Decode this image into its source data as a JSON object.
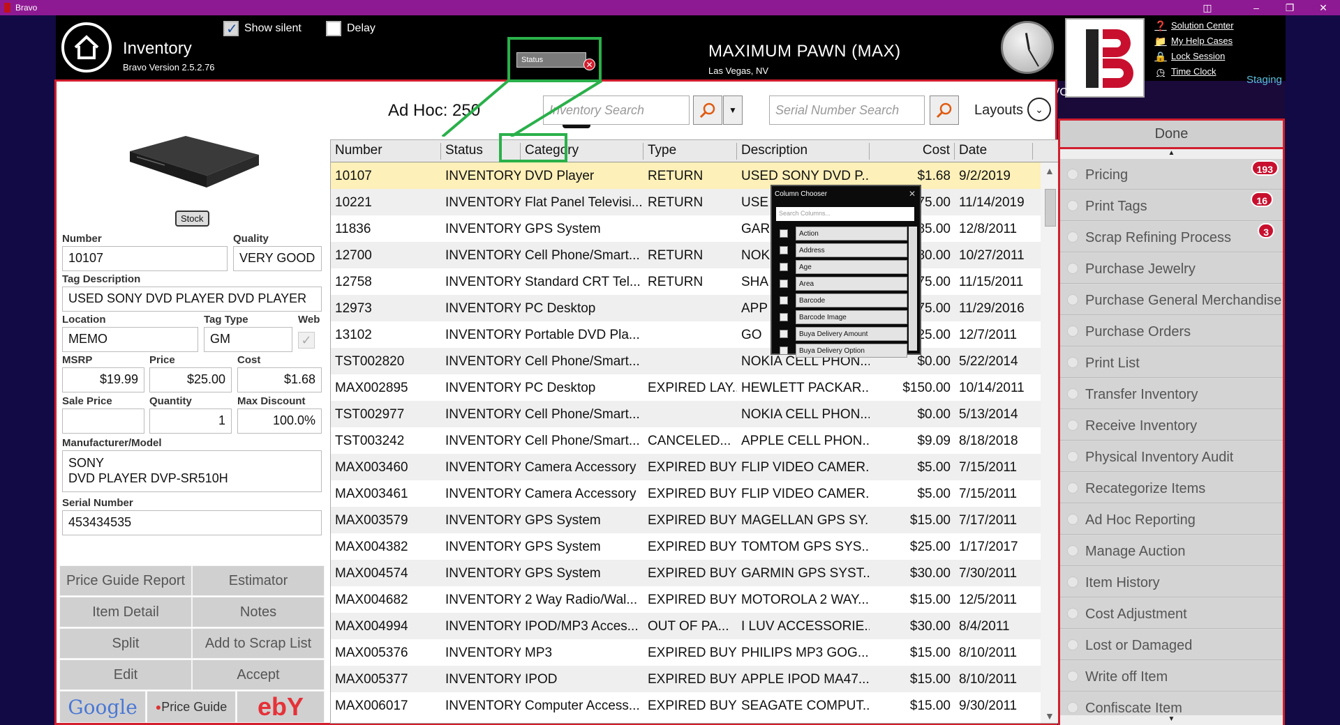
{
  "window": {
    "title": "Bravo"
  },
  "header": {
    "module_title": "Inventory",
    "version": "Bravo Version 2.5.2.76",
    "show_silent_label": "Show silent",
    "delay_label": "Delay",
    "store_name": "MAXIMUM PAWN (MAX)",
    "store_location": "Las Vegas, NV",
    "brand_label": "BRAVO",
    "staging": "Staging",
    "links": [
      "Solution Center",
      "My Help Cases",
      "Lock Session",
      "Time Clock"
    ]
  },
  "detail": {
    "stock_badge": "Stock",
    "labels": {
      "number": "Number",
      "quality": "Quality",
      "tag_description": "Tag Description",
      "location": "Location",
      "tag_type": "Tag Type",
      "web": "Web",
      "msrp": "MSRP",
      "price": "Price",
      "cost": "Cost",
      "sale_price": "Sale Price",
      "quantity": "Quantity",
      "max_discount": "Max Discount",
      "manufacturer_model": "Manufacturer/Model",
      "serial_number": "Serial Number"
    },
    "values": {
      "number": "10107",
      "quality": "VERY GOOD",
      "tag_description": "USED SONY DVD PLAYER DVD PLAYER",
      "location": "MEMO",
      "tag_type": "GM",
      "msrp": "$19.99",
      "price": "$25.00",
      "cost": "$1.68",
      "sale_price": "",
      "quantity": "1",
      "max_discount": "100.0%",
      "manufacturer": "SONY",
      "model": "DVD PLAYER DVP-SR510H",
      "serial_number": "453434535"
    },
    "buttons": [
      "Price Guide Report",
      "Estimator",
      "Item Detail",
      "Notes",
      "Split",
      "Add to Scrap List",
      "Edit",
      "Accept"
    ],
    "link_buttons": {
      "google": "Google",
      "price_guide": "Price Guide",
      "ebay": "ebY"
    }
  },
  "toolbar": {
    "adhoc": "Ad Hoc: 250",
    "inventory_search_placeholder": "Inventory Search",
    "serial_search_placeholder": "Serial Number Search",
    "layouts": "Layouts"
  },
  "drag_chip": "Status",
  "grid": {
    "columns": [
      "Number",
      "Status",
      "Category",
      "Type",
      "Description",
      "Cost",
      "Date"
    ],
    "rows": [
      [
        "10107",
        "INVENTORY",
        "DVD Player",
        "RETURN",
        "USED SONY DVD P...",
        "$1.68",
        "9/2/2019"
      ],
      [
        "10221",
        "INVENTORY",
        "Flat Panel Televisi...",
        "RETURN",
        "USE",
        "75.00",
        "11/14/2019"
      ],
      [
        "11836",
        "INVENTORY",
        "GPS System",
        "",
        "GAR",
        "85.00",
        "12/8/2011"
      ],
      [
        "12700",
        "INVENTORY",
        "Cell Phone/Smart...",
        "RETURN",
        "NOK",
        "80.00",
        "10/27/2011"
      ],
      [
        "12758",
        "INVENTORY",
        "Standard CRT Tel...",
        "RETURN",
        "SHA",
        "75.00",
        "11/15/2011"
      ],
      [
        "12973",
        "INVENTORY",
        "PC Desktop",
        "",
        "APP",
        "75.00",
        "11/29/2016"
      ],
      [
        "13102",
        "INVENTORY",
        "Portable DVD Pla...",
        "",
        "GO",
        "25.00",
        "12/7/2011"
      ],
      [
        "TST002820",
        "INVENTORY",
        "Cell Phone/Smart...",
        "",
        "NOKIA CELL PHON...",
        "$0.00",
        "5/22/2014"
      ],
      [
        "MAX002895",
        "INVENTORY",
        "PC Desktop",
        "EXPIRED LAY...",
        "HEWLETT PACKAR...",
        "$150.00",
        "10/14/2011"
      ],
      [
        "TST002977",
        "INVENTORY",
        "Cell Phone/Smart...",
        "",
        "NOKIA CELL PHON...",
        "$0.00",
        "5/13/2014"
      ],
      [
        "TST003242",
        "INVENTORY",
        "Cell Phone/Smart...",
        "CANCELED...",
        "APPLE CELL PHON...",
        "$9.09",
        "8/18/2018"
      ],
      [
        "MAX003460",
        "INVENTORY",
        "Camera Accessory",
        "EXPIRED BUY",
        "FLIP VIDEO CAMER...",
        "$5.00",
        "7/15/2011"
      ],
      [
        "MAX003461",
        "INVENTORY",
        "Camera Accessory",
        "EXPIRED BUY",
        "FLIP VIDEO CAMER...",
        "$5.00",
        "7/15/2011"
      ],
      [
        "MAX003579",
        "INVENTORY",
        "GPS System",
        "EXPIRED BUY",
        "MAGELLAN GPS SY...",
        "$15.00",
        "7/17/2011"
      ],
      [
        "MAX004382",
        "INVENTORY",
        "GPS System",
        "EXPIRED BUY",
        "TOMTOM GPS SYS...",
        "$25.00",
        "1/17/2017"
      ],
      [
        "MAX004574",
        "INVENTORY",
        "GPS System",
        "EXPIRED BUY",
        "GARMIN GPS SYST...",
        "$30.00",
        "7/30/2011"
      ],
      [
        "MAX004682",
        "INVENTORY",
        "2 Way Radio/Wal...",
        "EXPIRED BUY",
        "MOTOROLA 2 WAY...",
        "$15.00",
        "12/5/2011"
      ],
      [
        "MAX004994",
        "INVENTORY",
        "IPOD/MP3 Acces...",
        "OUT OF PA...",
        "I LUV ACCESSORIE...",
        "$30.00",
        "8/4/2011"
      ],
      [
        "MAX005376",
        "INVENTORY",
        "MP3",
        "EXPIRED BUY",
        "PHILIPS MP3 GOG...",
        "$15.00",
        "8/10/2011"
      ],
      [
        "MAX005377",
        "INVENTORY",
        "IPOD",
        "EXPIRED BUY",
        "APPLE IPOD MA47...",
        "$15.00",
        "8/10/2011"
      ],
      [
        "MAX006017",
        "INVENTORY",
        "Computer Access...",
        "EXPIRED BUY",
        "SEAGATE COMPUT...",
        "$15.00",
        "9/30/2011"
      ]
    ]
  },
  "column_chooser": {
    "title": "Column Chooser",
    "search_placeholder": "Search Columns...",
    "items": [
      "Action",
      "Address",
      "Age",
      "Area",
      "Barcode",
      "Barcode Image",
      "Buya Delivery Amount",
      "Buya Delivery Option"
    ]
  },
  "right_menu": {
    "done": "Done",
    "items": [
      {
        "label": "Pricing",
        "badge": "193"
      },
      {
        "label": "Print Tags",
        "badge": "16"
      },
      {
        "label": "Scrap Refining Process",
        "badge": "3"
      },
      {
        "label": "Purchase Jewelry",
        "badge": ""
      },
      {
        "label": "Purchase General Merchandise",
        "badge": ""
      },
      {
        "label": "Purchase Orders",
        "badge": ""
      },
      {
        "label": "Print List",
        "badge": ""
      },
      {
        "label": "Transfer Inventory",
        "badge": ""
      },
      {
        "label": "Receive Inventory",
        "badge": ""
      },
      {
        "label": "Physical Inventory Audit",
        "badge": ""
      },
      {
        "label": "Recategorize Items",
        "badge": ""
      },
      {
        "label": "Ad Hoc Reporting",
        "badge": ""
      },
      {
        "label": "Manage Auction",
        "badge": ""
      },
      {
        "label": "Item History",
        "badge": ""
      },
      {
        "label": "Cost Adjustment",
        "badge": ""
      },
      {
        "label": "Lost or Damaged",
        "badge": ""
      },
      {
        "label": "Write off Item",
        "badge": ""
      },
      {
        "label": "Confiscate Item",
        "badge": ""
      }
    ]
  }
}
